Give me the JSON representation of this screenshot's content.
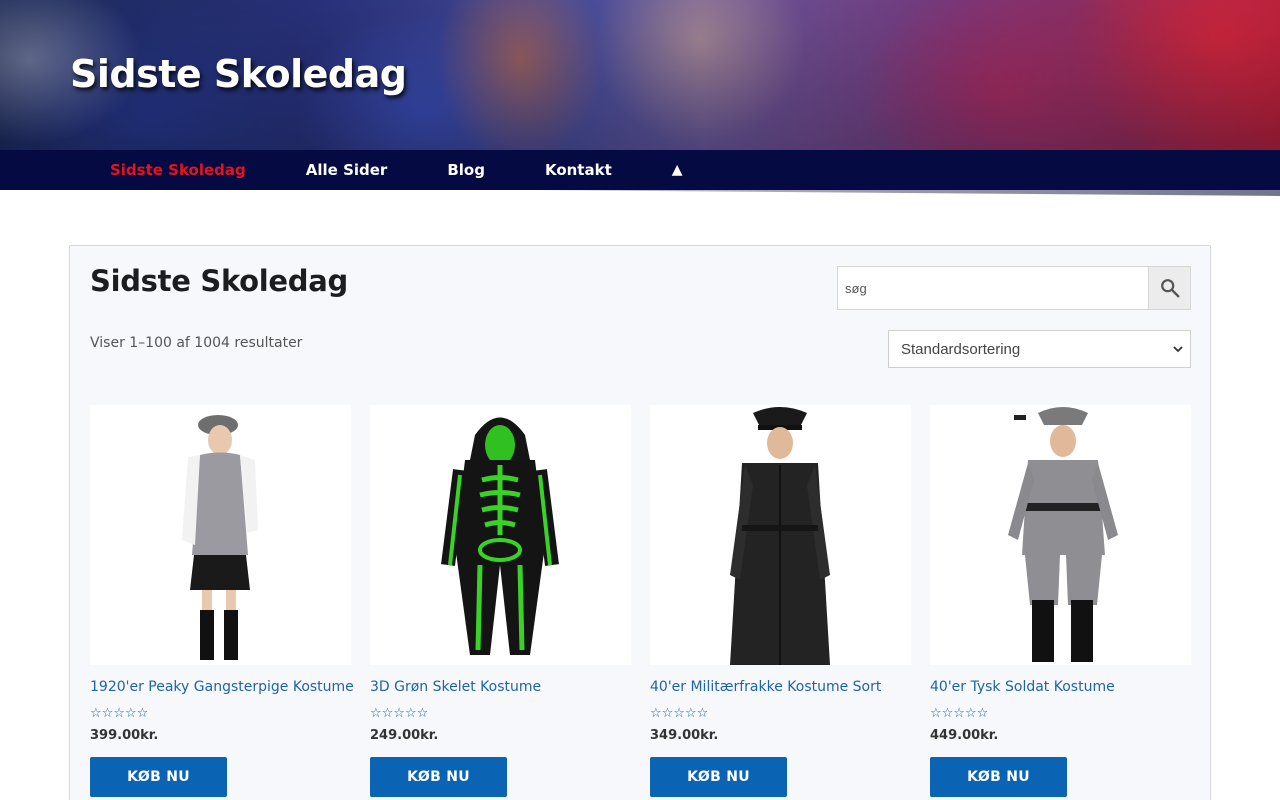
{
  "header": {
    "site_title": "Sidste Skoledag"
  },
  "nav": {
    "items": [
      {
        "label": "Sidste Skoledag",
        "active": true
      },
      {
        "label": "Alle Sider",
        "active": false
      },
      {
        "label": "Blog",
        "active": false
      },
      {
        "label": "Kontakt",
        "active": false
      }
    ],
    "more_icon": "up-triangle-icon",
    "more_glyph": "▲",
    "active_color": "#e8121a",
    "bg_color": "#050a42"
  },
  "main": {
    "title": "Sidste Skoledag",
    "search": {
      "placeholder": "søg",
      "icon": "search-icon"
    },
    "result_count": "Viser 1–100 af 1004 resultater",
    "sort": {
      "selected": "Standardsortering",
      "icon": "chevron-down-icon"
    }
  },
  "products": [
    {
      "name": "1920'er Peaky Gangsterpige Kostume",
      "stars": "☆☆☆☆☆",
      "price": "399.00kr.",
      "buy_label": "KØB NU",
      "rating": 0
    },
    {
      "name": "3D Grøn Skelet Kostume",
      "stars": "☆☆☆☆☆",
      "price": "249.00kr.",
      "buy_label": "KØB NU",
      "rating": 0
    },
    {
      "name": "40'er Militærfrakke Kostume Sort",
      "stars": "☆☆☆☆☆",
      "price": "349.00kr.",
      "buy_label": "KØB NU",
      "rating": 0
    },
    {
      "name": "40'er Tysk Soldat Kostume",
      "stars": "☆☆☆☆☆",
      "price": "449.00kr.",
      "buy_label": "KØB NU",
      "rating": 0
    }
  ],
  "colors": {
    "link": "#1f63a8",
    "button": "#0b64b3"
  }
}
